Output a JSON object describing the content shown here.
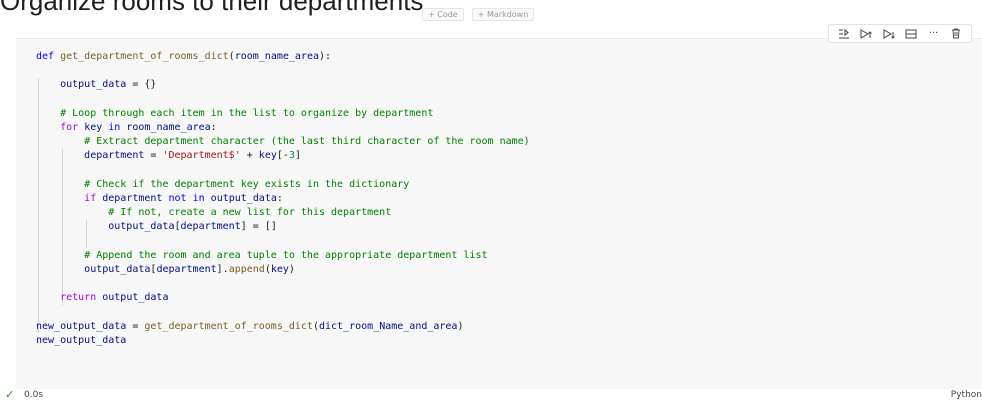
{
  "markdown": {
    "heading": "Organize rooms to their departments"
  },
  "insert_bar": {
    "code": "+ Code",
    "markdown": "+ Markdown"
  },
  "cell_toolbar": {
    "icons": [
      "run-by-line-icon",
      "execute-above-icon",
      "execute-below-icon",
      "split-cell-icon",
      "more-actions-icon",
      "delete-icon"
    ],
    "more_label": "···"
  },
  "code_cell": {
    "lines": [
      "def get_department_of_rooms_dict(room_name_area):",
      "",
      "    output_data = {}",
      "",
      "    # Loop through each item in the list to organize by department",
      "    for key in room_name_area:",
      "        # Extract department character (the last third character of the room name)",
      "        department = 'Department$' + key[-3]",
      "",
      "        # Check if the department key exists in the dictionary",
      "        if department not in output_data:",
      "            # If not, create a new list for this department",
      "            output_data[department] = []",
      "",
      "        # Append the room and area tuple to the appropriate department list",
      "        output_data[department].append(key)",
      "",
      "    return output_data",
      "",
      "new_output_data = get_department_of_rooms_dict(dict_room_Name_and_area)",
      "new_output_data"
    ]
  },
  "status": {
    "execution_time": "0.0s",
    "language": "Python"
  }
}
